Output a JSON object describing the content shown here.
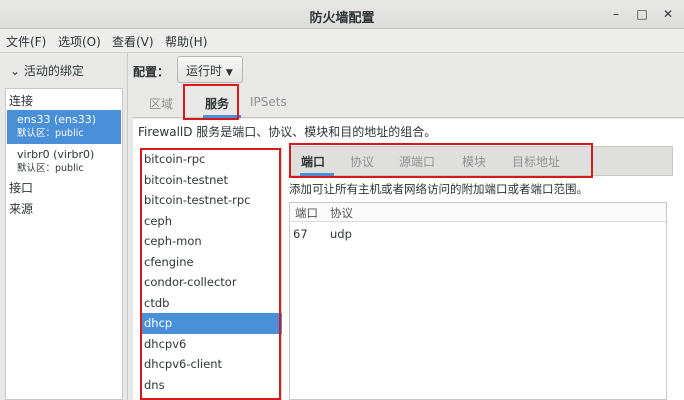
{
  "window": {
    "title": "防火墙配置",
    "minimize_glyph": "–",
    "maximize_glyph": "□",
    "close_glyph": "✕"
  },
  "menu": [
    "文件(F)",
    "选项(O)",
    "查看(V)",
    "帮助(H)"
  ],
  "sidebar": {
    "bindings_toggle": "活动的绑定",
    "connections_header": "连接",
    "interfaces": [
      {
        "name": "ens33 (ens33)",
        "zone": "默认区：public",
        "selected": true
      },
      {
        "name": "virbr0 (virbr0)",
        "zone": "默认区：public",
        "selected": false
      }
    ],
    "ports_header": "接口",
    "sources_header": "来源"
  },
  "config": {
    "label": "配置：",
    "mode": "运行时"
  },
  "tabs": [
    "区域",
    "服务",
    "IPSets"
  ],
  "active_tab": "服务",
  "services_description": "FirewallD 服务是端口、协议、模块和目的地址的组合。",
  "services": [
    "bitcoin-rpc",
    "bitcoin-testnet",
    "bitcoin-testnet-rpc",
    "ceph",
    "ceph-mon",
    "cfengine",
    "condor-collector",
    "ctdb",
    "dhcp",
    "dhcpv6",
    "dhcpv6-client",
    "dns"
  ],
  "selected_service": "dhcp",
  "detail": {
    "subtabs": [
      "端口",
      "协议",
      "源端口",
      "模块",
      "目标地址"
    ],
    "active_subtab": "端口",
    "description": "添加可让所有主机或者网络访问的附加端口或者端口范围。",
    "columns": [
      "端口",
      "协议"
    ],
    "rows": [
      [
        "67",
        "udp"
      ]
    ]
  },
  "colors": {
    "selection": "#4a90d9",
    "highlight_box": "#d7191c"
  }
}
